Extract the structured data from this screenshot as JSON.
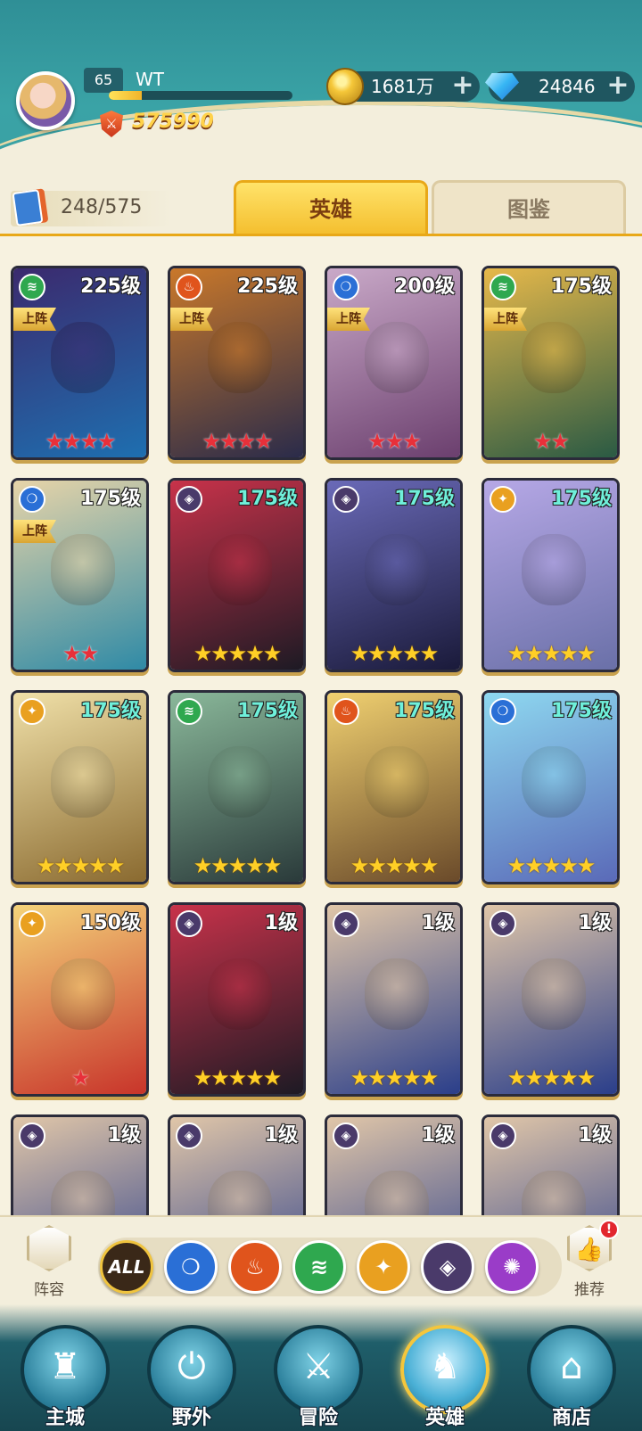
{
  "player": {
    "level": "65",
    "name": "WT",
    "exp_fraction": 0.18,
    "power": "575990"
  },
  "currency": {
    "gold": "1681万",
    "gems": "24846"
  },
  "hero_count": "248/575",
  "tabs": {
    "heroes": "英雄",
    "codex": "图鉴"
  },
  "colors": {
    "wind": "#2fa84f",
    "fire": "#e0541c",
    "water": "#2a6fd6",
    "dark": "#4a3a6a",
    "light": "#e9a020",
    "arcane": "#9a3cc8",
    "red_star": "#e8303a",
    "gold_star": "#ffcf26"
  },
  "heroes": [
    {
      "level": "225级",
      "element": "wind",
      "deployed": "上阵",
      "stars": 4,
      "star_color": "red",
      "bg": [
        "#3b2a6e",
        "#1e6fb0"
      ],
      "teal": false
    },
    {
      "level": "225级",
      "element": "fire",
      "deployed": "上阵",
      "stars": 4,
      "star_color": "red",
      "bg": [
        "#c9782a",
        "#2a2b4a"
      ],
      "teal": false
    },
    {
      "level": "200级",
      "element": "water",
      "deployed": "上阵",
      "stars": 3,
      "star_color": "red",
      "bg": [
        "#c9a9c8",
        "#6b3f6e"
      ],
      "teal": false
    },
    {
      "level": "175级",
      "element": "wind",
      "deployed": "上阵",
      "stars": 2,
      "star_color": "red",
      "bg": [
        "#e6b84a",
        "#2a5a44"
      ],
      "teal": false
    },
    {
      "level": "175级",
      "element": "water",
      "deployed": "上阵",
      "stars": 2,
      "star_color": "red",
      "bg": [
        "#e7d4a8",
        "#2f8aa6"
      ],
      "teal": false
    },
    {
      "level": "175级",
      "element": "dark",
      "deployed": "",
      "stars": 5,
      "star_color": "gold",
      "bg": [
        "#c8324a",
        "#1d1a24"
      ],
      "teal": true
    },
    {
      "level": "175级",
      "element": "dark",
      "deployed": "",
      "stars": 5,
      "star_color": "gold",
      "bg": [
        "#6a6ab8",
        "#1a1a3a"
      ],
      "teal": true
    },
    {
      "level": "175级",
      "element": "light",
      "deployed": "",
      "stars": 5,
      "star_color": "gold",
      "bg": [
        "#b6a8e6",
        "#6a70a8"
      ],
      "teal": true
    },
    {
      "level": "175级",
      "element": "light",
      "deployed": "",
      "stars": 5,
      "star_color": "gold",
      "bg": [
        "#f0e0a8",
        "#8a6a30"
      ],
      "teal": true
    },
    {
      "level": "175级",
      "element": "wind",
      "deployed": "",
      "stars": 5,
      "star_color": "gold",
      "bg": [
        "#8ab89a",
        "#2a3a3a"
      ],
      "teal": true
    },
    {
      "level": "175级",
      "element": "fire",
      "deployed": "",
      "stars": 5,
      "star_color": "gold",
      "bg": [
        "#f0d070",
        "#6a4a2a"
      ],
      "teal": true
    },
    {
      "level": "175级",
      "element": "water",
      "deployed": "",
      "stars": 5,
      "star_color": "gold",
      "bg": [
        "#8ed8f0",
        "#5a6ab8"
      ],
      "teal": true
    },
    {
      "level": "150级",
      "element": "light",
      "deployed": "",
      "stars": 1,
      "star_color": "red",
      "bg": [
        "#f4d37a",
        "#c8342a"
      ],
      "teal": false
    },
    {
      "level": "1级",
      "element": "dark",
      "deployed": "",
      "stars": 5,
      "star_color": "gold",
      "bg": [
        "#c8324a",
        "#1d1a24"
      ],
      "teal": false
    },
    {
      "level": "1级",
      "element": "dark",
      "deployed": "",
      "stars": 5,
      "star_color": "gold",
      "bg": [
        "#e0c6a8",
        "#2a3e8a"
      ],
      "teal": false
    },
    {
      "level": "1级",
      "element": "dark",
      "deployed": "",
      "stars": 5,
      "star_color": "gold",
      "bg": [
        "#e0c6a8",
        "#2a3e8a"
      ],
      "teal": false
    },
    {
      "level": "1级",
      "element": "dark",
      "deployed": "",
      "stars": 0,
      "star_color": "gold",
      "bg": [
        "#e0c6a8",
        "#2a3e8a"
      ],
      "teal": false
    },
    {
      "level": "1级",
      "element": "dark",
      "deployed": "",
      "stars": 0,
      "star_color": "gold",
      "bg": [
        "#e0c6a8",
        "#2a3e8a"
      ],
      "teal": false
    },
    {
      "level": "1级",
      "element": "dark",
      "deployed": "",
      "stars": 0,
      "star_color": "gold",
      "bg": [
        "#e0c6a8",
        "#2a3e8a"
      ],
      "teal": false
    },
    {
      "level": "1级",
      "element": "dark",
      "deployed": "",
      "stars": 0,
      "star_color": "gold",
      "bg": [
        "#e0c6a8",
        "#2a3e8a"
      ],
      "teal": false
    }
  ],
  "filters": {
    "lineup": "阵容",
    "all": "ALL",
    "elements": [
      "water",
      "fire",
      "wind",
      "light",
      "dark",
      "arcane"
    ],
    "recommend": "推荐",
    "recommend_alert": "!"
  },
  "nav": [
    {
      "label": "主城",
      "icon": "castle-icon",
      "glyph": "♜",
      "active": false
    },
    {
      "label": "野外",
      "icon": "wild-gate-icon",
      "glyph": "⏻",
      "active": false
    },
    {
      "label": "冒险",
      "icon": "sword-icon",
      "glyph": "⚔",
      "active": false
    },
    {
      "label": "英雄",
      "icon": "knight-helmet-icon",
      "glyph": "♞",
      "active": true
    },
    {
      "label": "商店",
      "icon": "shop-icon",
      "glyph": "⌂",
      "active": false
    }
  ]
}
